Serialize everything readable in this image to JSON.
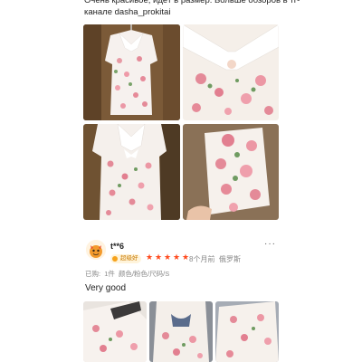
{
  "review_top": {
    "text": "Очень красивое, идёт в размер. Больше обзоров в тг-канале dasha_prokitai"
  },
  "review_2": {
    "username": "t**6",
    "badge": "超级好",
    "rating": 5,
    "star_glyph": "★",
    "time": "8个月前",
    "region": "俄罗斯",
    "more": "···",
    "purchase": {
      "prefix": "已购:",
      "quantity": "1件",
      "spec": "颜色/粉色/尺码/S"
    },
    "comment": "Very good"
  },
  "colors": {
    "star": "#ff4a1d",
    "meta_text": "#888888",
    "badge_text": "#c97a00",
    "badge_bg": "#fff4db"
  }
}
